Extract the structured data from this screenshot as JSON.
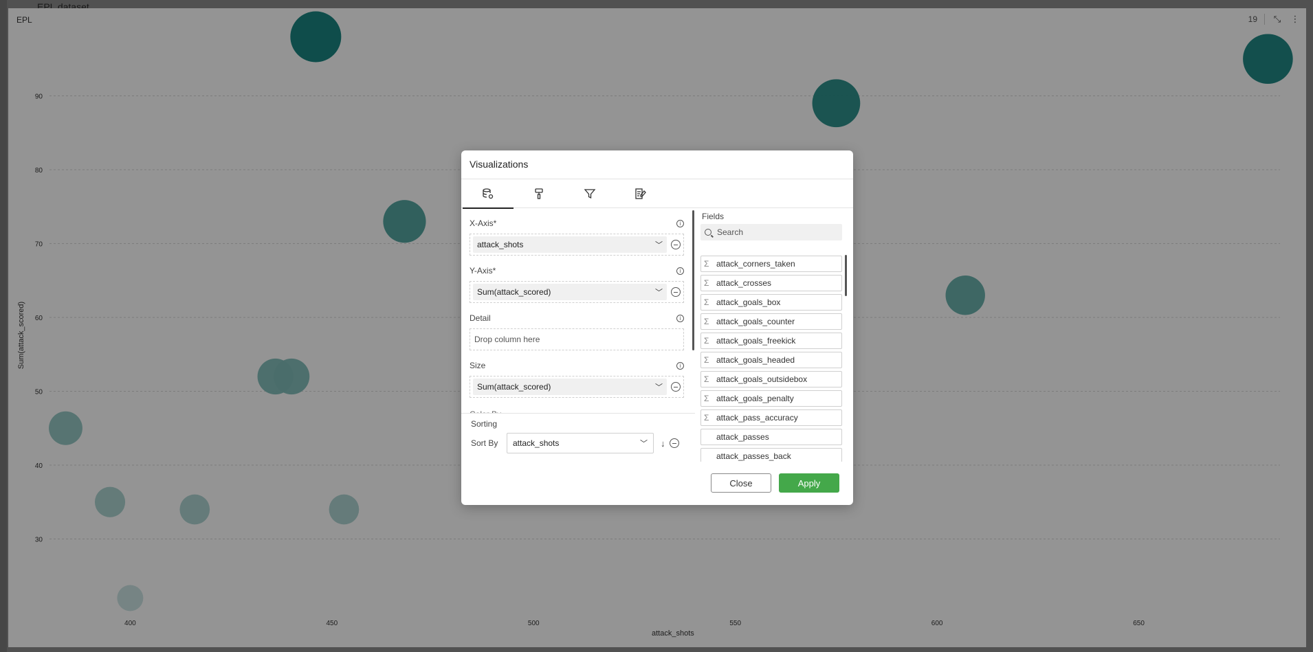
{
  "background": {
    "title": "EPL dataset"
  },
  "panel": {
    "title": "EPL",
    "count": "19",
    "collapse_icon": "collapse-icon",
    "menu_icon": "more-vertical-icon"
  },
  "chart_data": {
    "type": "scatter",
    "xlabel": "attack_shots",
    "ylabel": "Sum(attack_scored)",
    "xlim": [
      380,
      685
    ],
    "ylim": [
      20,
      100
    ],
    "xticks": [
      400,
      450,
      500,
      550,
      600,
      650
    ],
    "yticks": [
      30,
      40,
      50,
      60,
      70,
      80,
      90
    ],
    "grid": "horizontal",
    "points": [
      {
        "x": 446,
        "y": 98,
        "size": 98
      },
      {
        "x": 384,
        "y": 45,
        "size": 45
      },
      {
        "x": 395,
        "y": 35,
        "size": 35
      },
      {
        "x": 400,
        "y": 22,
        "size": 22
      },
      {
        "x": 416,
        "y": 34,
        "size": 34
      },
      {
        "x": 453,
        "y": 34,
        "size": 34
      },
      {
        "x": 436,
        "y": 52,
        "size": 52
      },
      {
        "x": 440,
        "y": 52,
        "size": 52
      },
      {
        "x": 468,
        "y": 73,
        "size": 73
      },
      {
        "x": 575,
        "y": 89,
        "size": 89
      },
      {
        "x": 607,
        "y": 63,
        "size": 63
      },
      {
        "x": 682,
        "y": 95,
        "size": 95
      }
    ],
    "colors": {
      "high": "#0e7f7a",
      "low": "#c9e3e1"
    }
  },
  "modal": {
    "title": "Visualizations",
    "tabs": [
      {
        "name": "data-tab",
        "icon": "database-settings-icon"
      },
      {
        "name": "format-tab",
        "icon": "paint-roller-icon"
      },
      {
        "name": "filter-tab",
        "icon": "filter-icon"
      },
      {
        "name": "analytics-tab",
        "icon": "edit-chart-icon"
      }
    ],
    "x_axis": {
      "label": "X-Axis*",
      "value": "attack_shots"
    },
    "y_axis": {
      "label": "Y-Axis*",
      "value": "Sum(attack_scored)"
    },
    "detail": {
      "label": "Detail",
      "placeholder": "Drop column here"
    },
    "size": {
      "label": "Size",
      "value": "Sum(attack_scored)"
    },
    "color_by_cut": "Color By",
    "sorting": {
      "title": "Sorting",
      "sort_by_label": "Sort By",
      "sort_by_value": "attack_shots"
    },
    "fields": {
      "label": "Fields",
      "search_placeholder": "Search",
      "items": [
        {
          "name": "attack_corners_taken",
          "measure": true
        },
        {
          "name": "attack_crosses",
          "measure": true
        },
        {
          "name": "attack_goals_box",
          "measure": true
        },
        {
          "name": "attack_goals_counter",
          "measure": true
        },
        {
          "name": "attack_goals_freekick",
          "measure": true
        },
        {
          "name": "attack_goals_headed",
          "measure": true
        },
        {
          "name": "attack_goals_outsidebox",
          "measure": true
        },
        {
          "name": "attack_goals_penalty",
          "measure": true
        },
        {
          "name": "attack_pass_accuracy",
          "measure": true
        },
        {
          "name": "attack_passes",
          "measure": false
        },
        {
          "name": "attack_passes_back",
          "measure": false
        }
      ]
    },
    "buttons": {
      "close": "Close",
      "apply": "Apply"
    },
    "colors": {
      "apply": "#44a84a"
    }
  }
}
